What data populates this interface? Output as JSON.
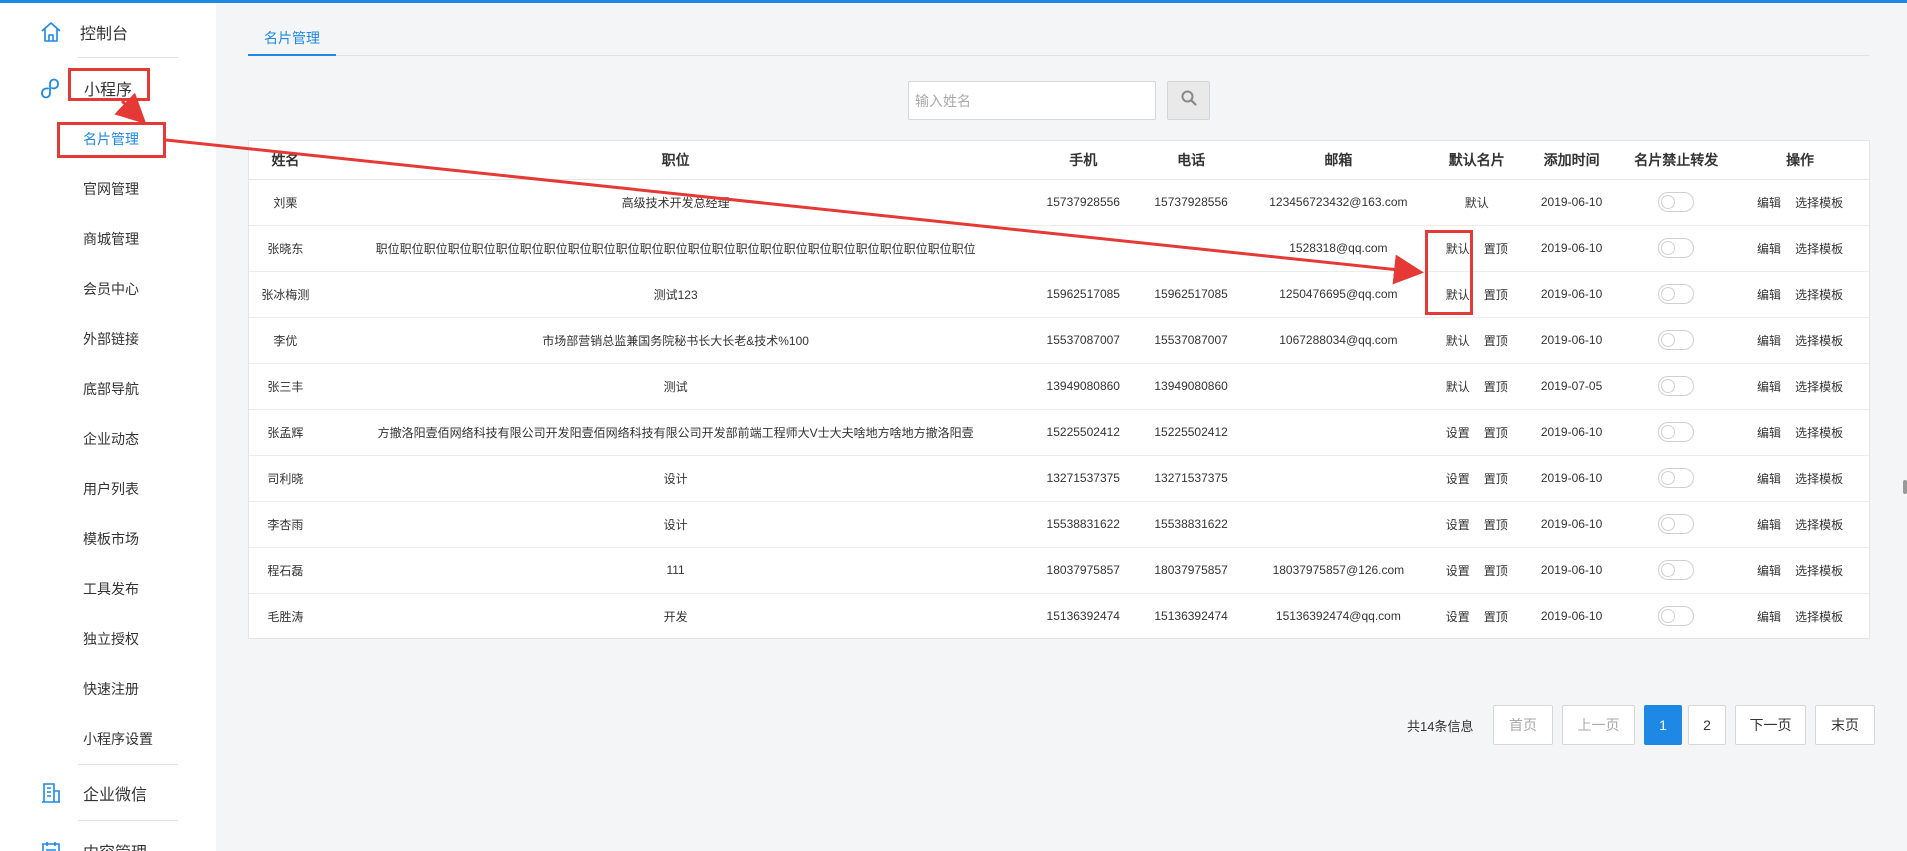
{
  "sidebar": {
    "groups": [
      {
        "label": "控制台",
        "icon": "home-icon"
      },
      {
        "label": "小程序",
        "icon": "miniprogram-icon"
      },
      {
        "label": "企业微信",
        "icon": "enterprise-icon"
      },
      {
        "label": "内容管理",
        "icon": "content-icon"
      }
    ],
    "items": [
      "名片管理",
      "官网管理",
      "商城管理",
      "会员中心",
      "外部链接",
      "底部导航",
      "企业动态",
      "用户列表",
      "模板市场",
      "工具发布",
      "独立授权",
      "快速注册",
      "小程序设置"
    ]
  },
  "tabs": {
    "active": "名片管理"
  },
  "search": {
    "placeholder": "输入姓名",
    "icon": "search-icon"
  },
  "table": {
    "headers": [
      "姓名",
      "职位",
      "手机",
      "电话",
      "邮箱",
      "默认名片",
      "添加时间",
      "名片禁止转发",
      "操作"
    ],
    "rows": [
      {
        "name": "刘栗",
        "position": "高级技术开发总经理",
        "mobile": "15737928556",
        "phone": "15737928556",
        "email": "123456723432@163.com",
        "default_a": "默认",
        "default_b": "",
        "date": "2019-06-10",
        "edit": "编辑",
        "template": "选择模板"
      },
      {
        "name": "张晓东",
        "position": "职位职位职位职位职位职位职位职位职位职位职位职位职位职位职位职位职位职位职位职位职位职位职位职位职位",
        "mobile": "",
        "phone": "",
        "email": "1528318@qq.com",
        "default_a": "默认",
        "default_b": "置顶",
        "date": "2019-06-10",
        "edit": "编辑",
        "template": "选择模板"
      },
      {
        "name": "张冰梅测",
        "position": "测试123",
        "mobile": "15962517085",
        "phone": "15962517085",
        "email": "1250476695@qq.com",
        "default_a": "默认",
        "default_b": "置顶",
        "date": "2019-06-10",
        "edit": "编辑",
        "template": "选择模板"
      },
      {
        "name": "李优",
        "position": "市场部营销总监兼国务院秘书长大长老&技术%100",
        "mobile": "15537087007",
        "phone": "15537087007",
        "email": "1067288034@qq.com",
        "default_a": "默认",
        "default_b": "置顶",
        "date": "2019-06-10",
        "edit": "编辑",
        "template": "选择模板"
      },
      {
        "name": "张三丰",
        "position": "测试",
        "mobile": "13949080860",
        "phone": "13949080860",
        "email": "",
        "default_a": "默认",
        "default_b": "置顶",
        "date": "2019-07-05",
        "edit": "编辑",
        "template": "选择模板"
      },
      {
        "name": "张孟辉",
        "position": "方撤洛阳壹佰网络科技有限公司开发阳壹佰网络科技有限公司开发部前端工程师大V士大夫啥地方啥地方撤洛阳壹",
        "mobile": "15225502412",
        "phone": "15225502412",
        "email": "",
        "default_a": "设置",
        "default_b": "置顶",
        "date": "2019-06-10",
        "edit": "编辑",
        "template": "选择模板"
      },
      {
        "name": "司利晓",
        "position": "设计",
        "mobile": "13271537375",
        "phone": "13271537375",
        "email": "",
        "default_a": "设置",
        "default_b": "置顶",
        "date": "2019-06-10",
        "edit": "编辑",
        "template": "选择模板"
      },
      {
        "name": "李杏雨",
        "position": "设计",
        "mobile": "15538831622",
        "phone": "15538831622",
        "email": "",
        "default_a": "设置",
        "default_b": "置顶",
        "date": "2019-06-10",
        "edit": "编辑",
        "template": "选择模板"
      },
      {
        "name": "程石磊",
        "position": "111",
        "mobile": "18037975857",
        "phone": "18037975857",
        "email": "18037975857@126.com",
        "default_a": "设置",
        "default_b": "置顶",
        "date": "2019-06-10",
        "edit": "编辑",
        "template": "选择模板"
      },
      {
        "name": "毛胜涛",
        "position": "开发",
        "mobile": "15136392474",
        "phone": "15136392474",
        "email": "15136392474@qq.com",
        "default_a": "设置",
        "default_b": "置顶",
        "date": "2019-06-10",
        "edit": "编辑",
        "template": "选择模板"
      }
    ]
  },
  "pagination": {
    "total": "共14条信息",
    "first": "首页",
    "prev": "上一页",
    "pages": [
      "1",
      "2"
    ],
    "current": "1",
    "next": "下一页",
    "last": "末页"
  },
  "annotation": {
    "color": "#e53935"
  },
  "colors": {
    "accent": "#1e88e5",
    "highlight": "#e53935"
  }
}
